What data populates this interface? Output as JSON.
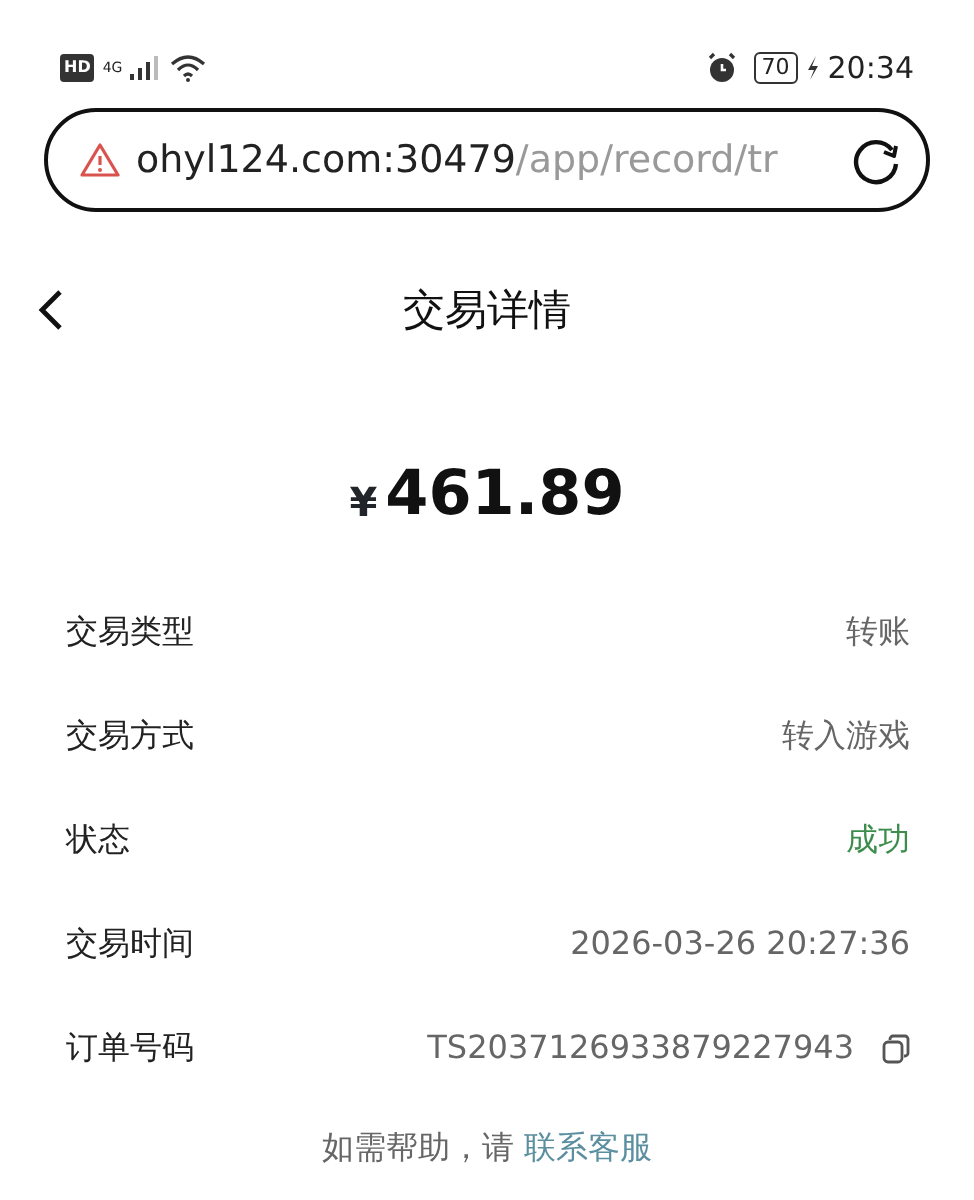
{
  "status_bar": {
    "hd": "HD",
    "network": "4G",
    "battery": "70",
    "time": "20:34"
  },
  "address_bar": {
    "host": "ohyl124.com:30479",
    "path": "/app/record/tr"
  },
  "header": {
    "title": "交易详情"
  },
  "amount": {
    "currency": "¥",
    "value": "461.89"
  },
  "details": [
    {
      "label": "交易类型",
      "value": "转账",
      "kind": "text"
    },
    {
      "label": "交易方式",
      "value": "转入游戏",
      "kind": "text"
    },
    {
      "label": "状态",
      "value": "成功",
      "kind": "status"
    },
    {
      "label": "交易时间",
      "value": "2026-03-26 20:27:36",
      "kind": "text"
    },
    {
      "label": "订单号码",
      "value": "TS2037126933879227943",
      "kind": "copyable"
    }
  ],
  "help": {
    "text": "如需帮助，请",
    "link": "联系客服"
  }
}
